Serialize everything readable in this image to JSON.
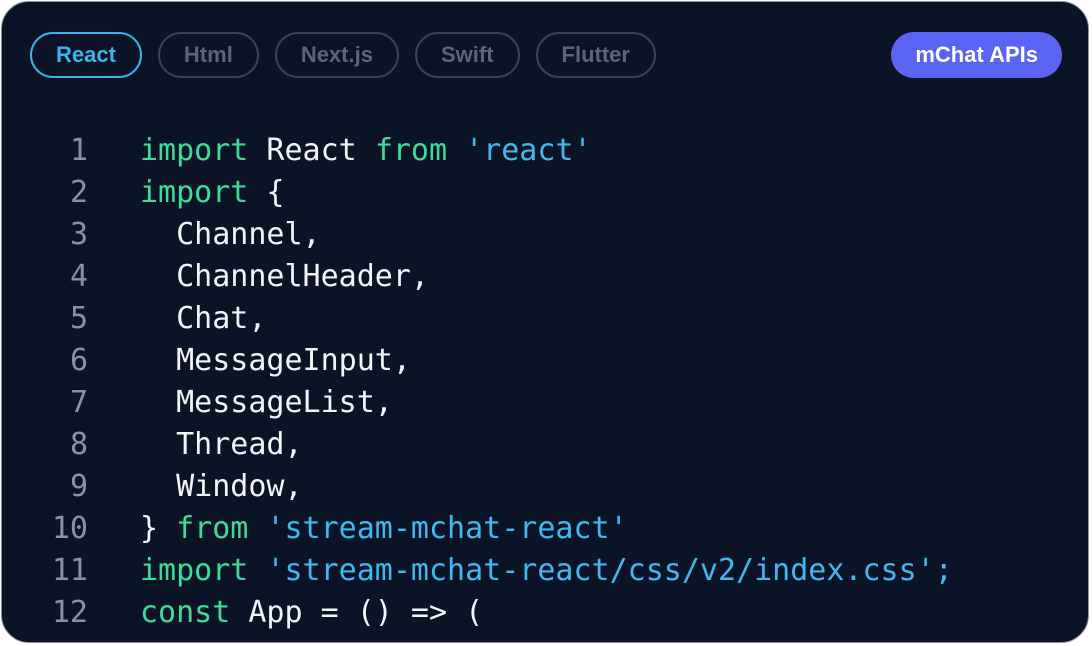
{
  "tabs": [
    {
      "label": "React",
      "active": true
    },
    {
      "label": "Html",
      "active": false
    },
    {
      "label": "Next.js",
      "active": false
    },
    {
      "label": "Swift",
      "active": false
    },
    {
      "label": "Flutter",
      "active": false
    }
  ],
  "api_button": {
    "label": "mChat APIs"
  },
  "code": {
    "lines": [
      {
        "num": "1",
        "tokens": [
          {
            "t": "import",
            "c": "kw"
          },
          {
            "t": " React ",
            "c": "plain"
          },
          {
            "t": "from",
            "c": "kw"
          },
          {
            "t": " ",
            "c": "plain"
          },
          {
            "t": "'react'",
            "c": "str"
          }
        ]
      },
      {
        "num": "2",
        "tokens": [
          {
            "t": "import",
            "c": "kw"
          },
          {
            "t": " {",
            "c": "plain"
          }
        ]
      },
      {
        "num": "3",
        "tokens": [
          {
            "t": "  Channel,",
            "c": "plain"
          }
        ]
      },
      {
        "num": "4",
        "tokens": [
          {
            "t": "  ChannelHeader,",
            "c": "plain"
          }
        ]
      },
      {
        "num": "5",
        "tokens": [
          {
            "t": "  Chat,",
            "c": "plain"
          }
        ]
      },
      {
        "num": "6",
        "tokens": [
          {
            "t": "  MessageInput,",
            "c": "plain"
          }
        ]
      },
      {
        "num": "7",
        "tokens": [
          {
            "t": "  MessageList,",
            "c": "plain"
          }
        ]
      },
      {
        "num": "8",
        "tokens": [
          {
            "t": "  Thread,",
            "c": "plain"
          }
        ]
      },
      {
        "num": "9",
        "tokens": [
          {
            "t": "  Window,",
            "c": "plain"
          }
        ]
      },
      {
        "num": "10",
        "tokens": [
          {
            "t": "} ",
            "c": "plain"
          },
          {
            "t": "from",
            "c": "kw"
          },
          {
            "t": " ",
            "c": "plain"
          },
          {
            "t": "'stream-mchat-react'",
            "c": "str"
          }
        ]
      },
      {
        "num": "11",
        "tokens": [
          {
            "t": "import",
            "c": "kw"
          },
          {
            "t": " ",
            "c": "plain"
          },
          {
            "t": "'stream-mchat-react/css/v2/index.css';",
            "c": "str"
          }
        ]
      },
      {
        "num": "12",
        "tokens": [
          {
            "t": "const",
            "c": "kw"
          },
          {
            "t": " App = () => (",
            "c": "plain"
          }
        ]
      }
    ]
  },
  "colors": {
    "background": "#0b1327",
    "accent": "#38b6ec",
    "button": "#5b63f3",
    "keyword": "#3ddc97",
    "string": "#3fb9ee"
  }
}
